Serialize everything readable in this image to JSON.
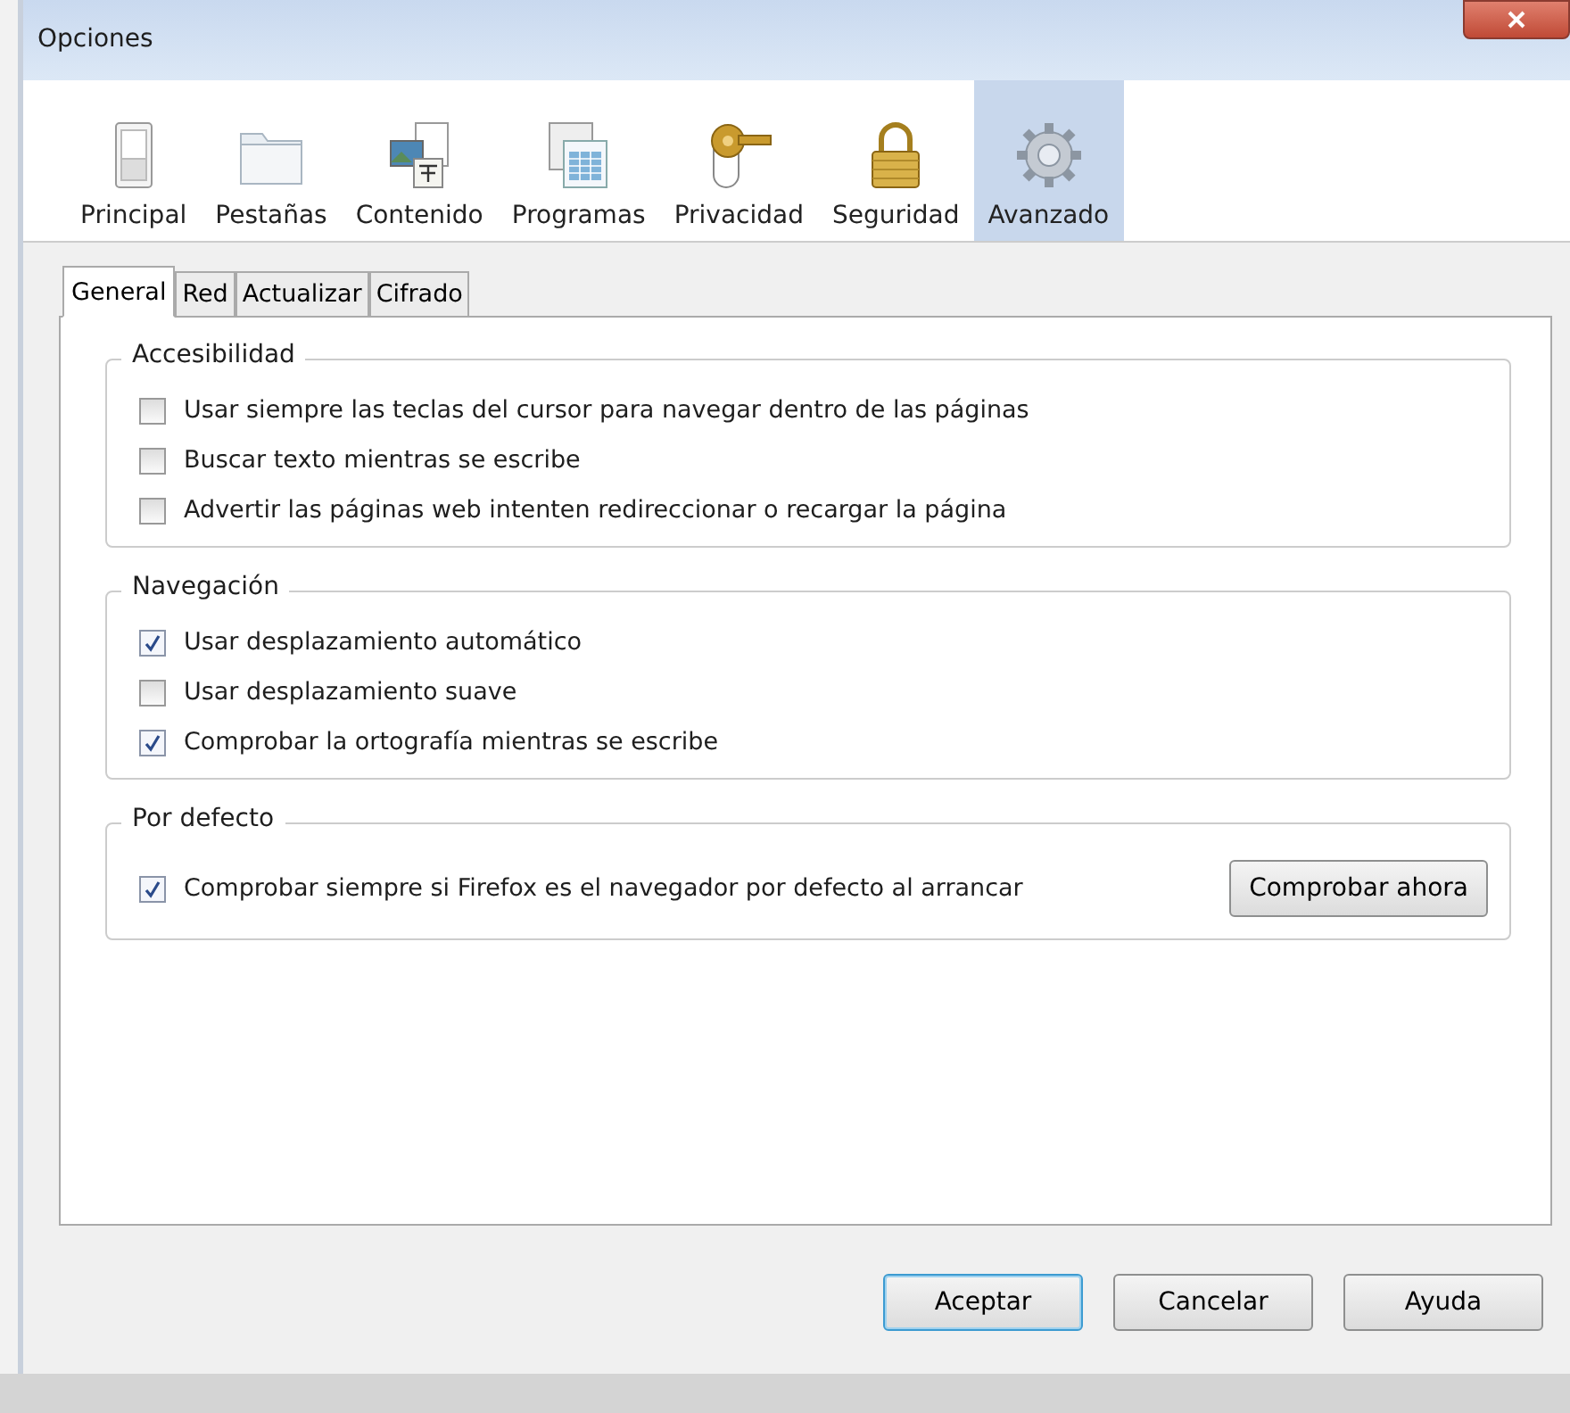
{
  "window": {
    "title": "Opciones"
  },
  "toolbar": [
    {
      "label": "Principal",
      "selected": false
    },
    {
      "label": "Pestañas",
      "selected": false
    },
    {
      "label": "Contenido",
      "selected": false
    },
    {
      "label": "Programas",
      "selected": false
    },
    {
      "label": "Privacidad",
      "selected": false
    },
    {
      "label": "Seguridad",
      "selected": false
    },
    {
      "label": "Avanzado",
      "selected": true
    }
  ],
  "tabs": [
    {
      "label": "General",
      "selected": true
    },
    {
      "label": "Red",
      "selected": false
    },
    {
      "label": "Actualizar",
      "selected": false
    },
    {
      "label": "Cifrado",
      "selected": false
    }
  ],
  "groups": [
    {
      "title": "Accesibilidad",
      "options": [
        {
          "label": "Usar siempre las teclas del cursor para navegar dentro de las páginas",
          "checked": false
        },
        {
          "label": "Buscar texto mientras se escribe",
          "checked": false
        },
        {
          "label": "Advertir las páginas web intenten redireccionar o recargar la página",
          "checked": false
        }
      ]
    },
    {
      "title": "Navegación",
      "options": [
        {
          "label": "Usar desplazamiento automático",
          "checked": true
        },
        {
          "label": "Usar desplazamiento suave",
          "checked": false
        },
        {
          "label": "Comprobar la ortografía mientras se escribe",
          "checked": true
        }
      ]
    },
    {
      "title": "Por defecto",
      "options": [
        {
          "label": "Comprobar siempre si Firefox es el navegador por defecto al arrancar",
          "checked": true
        }
      ],
      "button": "Comprobar ahora"
    }
  ],
  "buttons": [
    {
      "label": "Aceptar",
      "default": true
    },
    {
      "label": "Cancelar",
      "default": false
    },
    {
      "label": "Ayuda",
      "default": false
    }
  ]
}
